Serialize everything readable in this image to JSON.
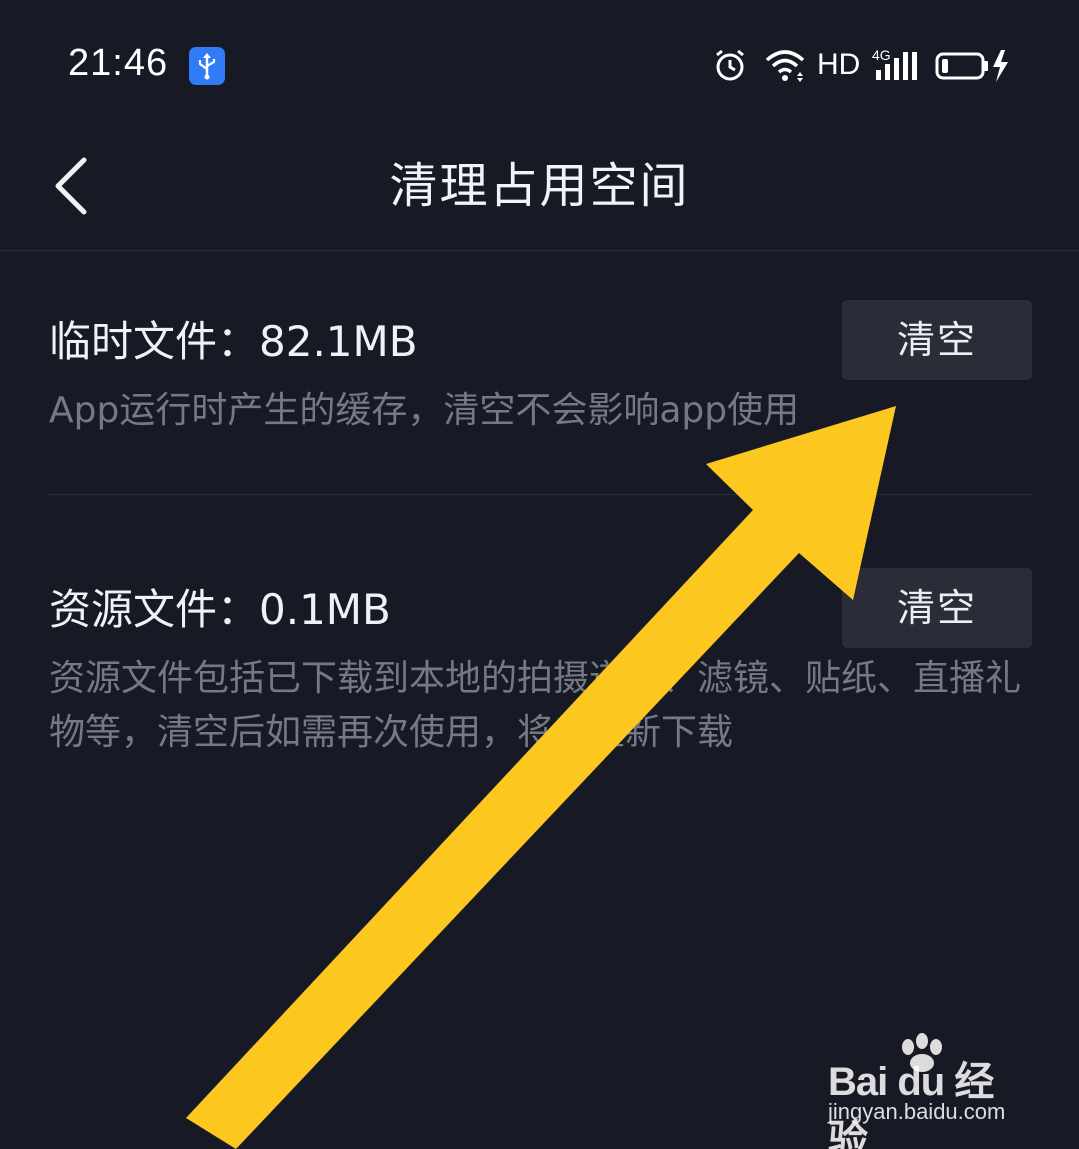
{
  "status_bar": {
    "time": "21:46",
    "network_label": "HD",
    "network_type": "4G",
    "icons": [
      "usb-debug-icon",
      "alarm-icon",
      "wifi-icon",
      "signal-icon",
      "battery-icon",
      "charging-icon"
    ]
  },
  "header": {
    "title": "清理占用空间",
    "back_icon": "chevron-left-icon"
  },
  "items": [
    {
      "title": "临时文件：82.1MB",
      "description": "App运行时产生的缓存，清空不会影响app使用",
      "button_label": "清空"
    },
    {
      "title": "资源文件：0.1MB",
      "description": "资源文件包括已下载到本地的拍摄道具、滤镜、贴纸、直播礼物等，清空后如需再次使用，将会重新下载",
      "button_label": "清空"
    }
  ],
  "overlay": {
    "arrow_color": "#fcc81f",
    "watermark_brand": "Bai du 经验",
    "watermark_url": "jingyan.baidu.com"
  },
  "colors": {
    "background": "#171a24",
    "button_bg": "#2a2d38",
    "desc_text": "#747985",
    "accent_badge": "#2f7cf6"
  }
}
